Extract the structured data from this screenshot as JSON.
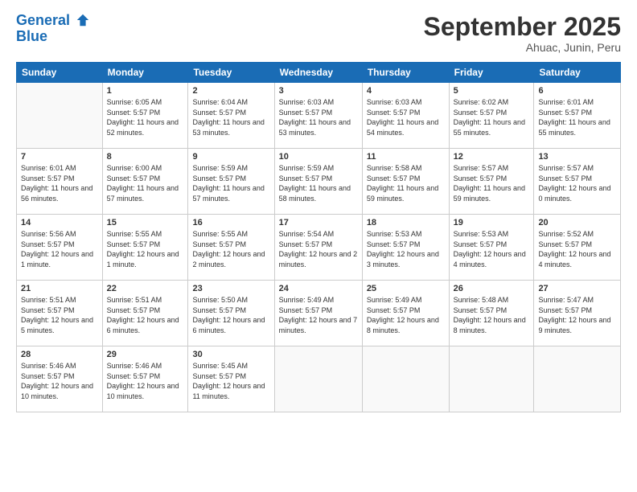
{
  "logo": {
    "line1": "General",
    "line2": "Blue"
  },
  "title": "September 2025",
  "subtitle": "Ahuac, Junin, Peru",
  "weekdays": [
    "Sunday",
    "Monday",
    "Tuesday",
    "Wednesday",
    "Thursday",
    "Friday",
    "Saturday"
  ],
  "weeks": [
    [
      {
        "num": "",
        "sunrise": "",
        "sunset": "",
        "daylight": ""
      },
      {
        "num": "1",
        "sunrise": "Sunrise: 6:05 AM",
        "sunset": "Sunset: 5:57 PM",
        "daylight": "Daylight: 11 hours and 52 minutes."
      },
      {
        "num": "2",
        "sunrise": "Sunrise: 6:04 AM",
        "sunset": "Sunset: 5:57 PM",
        "daylight": "Daylight: 11 hours and 53 minutes."
      },
      {
        "num": "3",
        "sunrise": "Sunrise: 6:03 AM",
        "sunset": "Sunset: 5:57 PM",
        "daylight": "Daylight: 11 hours and 53 minutes."
      },
      {
        "num": "4",
        "sunrise": "Sunrise: 6:03 AM",
        "sunset": "Sunset: 5:57 PM",
        "daylight": "Daylight: 11 hours and 54 minutes."
      },
      {
        "num": "5",
        "sunrise": "Sunrise: 6:02 AM",
        "sunset": "Sunset: 5:57 PM",
        "daylight": "Daylight: 11 hours and 55 minutes."
      },
      {
        "num": "6",
        "sunrise": "Sunrise: 6:01 AM",
        "sunset": "Sunset: 5:57 PM",
        "daylight": "Daylight: 11 hours and 55 minutes."
      }
    ],
    [
      {
        "num": "7",
        "sunrise": "Sunrise: 6:01 AM",
        "sunset": "Sunset: 5:57 PM",
        "daylight": "Daylight: 11 hours and 56 minutes."
      },
      {
        "num": "8",
        "sunrise": "Sunrise: 6:00 AM",
        "sunset": "Sunset: 5:57 PM",
        "daylight": "Daylight: 11 hours and 57 minutes."
      },
      {
        "num": "9",
        "sunrise": "Sunrise: 5:59 AM",
        "sunset": "Sunset: 5:57 PM",
        "daylight": "Daylight: 11 hours and 57 minutes."
      },
      {
        "num": "10",
        "sunrise": "Sunrise: 5:59 AM",
        "sunset": "Sunset: 5:57 PM",
        "daylight": "Daylight: 11 hours and 58 minutes."
      },
      {
        "num": "11",
        "sunrise": "Sunrise: 5:58 AM",
        "sunset": "Sunset: 5:57 PM",
        "daylight": "Daylight: 11 hours and 59 minutes."
      },
      {
        "num": "12",
        "sunrise": "Sunrise: 5:57 AM",
        "sunset": "Sunset: 5:57 PM",
        "daylight": "Daylight: 11 hours and 59 minutes."
      },
      {
        "num": "13",
        "sunrise": "Sunrise: 5:57 AM",
        "sunset": "Sunset: 5:57 PM",
        "daylight": "Daylight: 12 hours and 0 minutes."
      }
    ],
    [
      {
        "num": "14",
        "sunrise": "Sunrise: 5:56 AM",
        "sunset": "Sunset: 5:57 PM",
        "daylight": "Daylight: 12 hours and 1 minute."
      },
      {
        "num": "15",
        "sunrise": "Sunrise: 5:55 AM",
        "sunset": "Sunset: 5:57 PM",
        "daylight": "Daylight: 12 hours and 1 minute."
      },
      {
        "num": "16",
        "sunrise": "Sunrise: 5:55 AM",
        "sunset": "Sunset: 5:57 PM",
        "daylight": "Daylight: 12 hours and 2 minutes."
      },
      {
        "num": "17",
        "sunrise": "Sunrise: 5:54 AM",
        "sunset": "Sunset: 5:57 PM",
        "daylight": "Daylight: 12 hours and 2 minutes."
      },
      {
        "num": "18",
        "sunrise": "Sunrise: 5:53 AM",
        "sunset": "Sunset: 5:57 PM",
        "daylight": "Daylight: 12 hours and 3 minutes."
      },
      {
        "num": "19",
        "sunrise": "Sunrise: 5:53 AM",
        "sunset": "Sunset: 5:57 PM",
        "daylight": "Daylight: 12 hours and 4 minutes."
      },
      {
        "num": "20",
        "sunrise": "Sunrise: 5:52 AM",
        "sunset": "Sunset: 5:57 PM",
        "daylight": "Daylight: 12 hours and 4 minutes."
      }
    ],
    [
      {
        "num": "21",
        "sunrise": "Sunrise: 5:51 AM",
        "sunset": "Sunset: 5:57 PM",
        "daylight": "Daylight: 12 hours and 5 minutes."
      },
      {
        "num": "22",
        "sunrise": "Sunrise: 5:51 AM",
        "sunset": "Sunset: 5:57 PM",
        "daylight": "Daylight: 12 hours and 6 minutes."
      },
      {
        "num": "23",
        "sunrise": "Sunrise: 5:50 AM",
        "sunset": "Sunset: 5:57 PM",
        "daylight": "Daylight: 12 hours and 6 minutes."
      },
      {
        "num": "24",
        "sunrise": "Sunrise: 5:49 AM",
        "sunset": "Sunset: 5:57 PM",
        "daylight": "Daylight: 12 hours and 7 minutes."
      },
      {
        "num": "25",
        "sunrise": "Sunrise: 5:49 AM",
        "sunset": "Sunset: 5:57 PM",
        "daylight": "Daylight: 12 hours and 8 minutes."
      },
      {
        "num": "26",
        "sunrise": "Sunrise: 5:48 AM",
        "sunset": "Sunset: 5:57 PM",
        "daylight": "Daylight: 12 hours and 8 minutes."
      },
      {
        "num": "27",
        "sunrise": "Sunrise: 5:47 AM",
        "sunset": "Sunset: 5:57 PM",
        "daylight": "Daylight: 12 hours and 9 minutes."
      }
    ],
    [
      {
        "num": "28",
        "sunrise": "Sunrise: 5:46 AM",
        "sunset": "Sunset: 5:57 PM",
        "daylight": "Daylight: 12 hours and 10 minutes."
      },
      {
        "num": "29",
        "sunrise": "Sunrise: 5:46 AM",
        "sunset": "Sunset: 5:57 PM",
        "daylight": "Daylight: 12 hours and 10 minutes."
      },
      {
        "num": "30",
        "sunrise": "Sunrise: 5:45 AM",
        "sunset": "Sunset: 5:57 PM",
        "daylight": "Daylight: 12 hours and 11 minutes."
      },
      {
        "num": "",
        "sunrise": "",
        "sunset": "",
        "daylight": ""
      },
      {
        "num": "",
        "sunrise": "",
        "sunset": "",
        "daylight": ""
      },
      {
        "num": "",
        "sunrise": "",
        "sunset": "",
        "daylight": ""
      },
      {
        "num": "",
        "sunrise": "",
        "sunset": "",
        "daylight": ""
      }
    ]
  ]
}
